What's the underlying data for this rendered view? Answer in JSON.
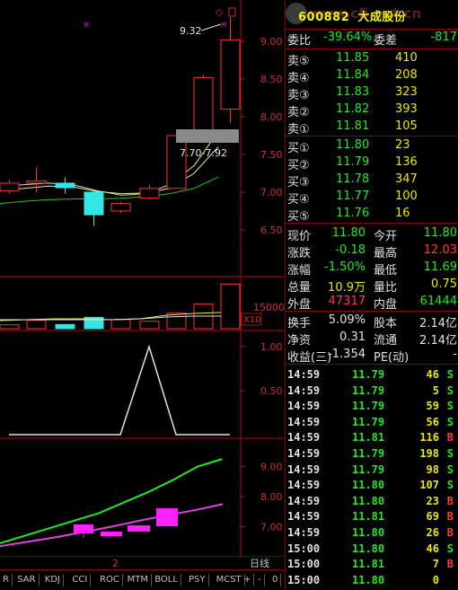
{
  "stock": {
    "code": "600882",
    "name": "大成股份",
    "watermark": "www.cfi.net.cn"
  },
  "chart": {
    "price_axis": [
      "9.00",
      "8.50",
      "8.00",
      "7.50",
      "7.00",
      "6.50"
    ],
    "volume_axis": "15000",
    "volume_unit": "X10",
    "kdj_axis": [
      "1.00",
      "0.50"
    ],
    "ma_axis": [
      "9.00",
      "8.00",
      "7.00"
    ],
    "peak_label": "9.32",
    "box_label": "7.70-7.92",
    "cursor_mark": "2",
    "period_label": "日线"
  },
  "chart_data": {
    "type": "candlestick",
    "candles": [
      {
        "open": 7.02,
        "close": 7.12,
        "high": 7.17,
        "low": 6.98
      },
      {
        "open": 7.12,
        "close": 7.15,
        "high": 7.33,
        "low": 7.0
      },
      {
        "open": 7.12,
        "close": 7.06,
        "high": 7.2,
        "low": 6.98
      },
      {
        "open": 7.0,
        "close": 6.7,
        "high": 7.01,
        "low": 6.55
      },
      {
        "open": 6.75,
        "close": 6.85,
        "high": 6.87,
        "low": 6.72
      },
      {
        "open": 6.92,
        "close": 7.05,
        "high": 7.1,
        "low": 6.9
      },
      {
        "open": 7.05,
        "close": 7.75,
        "high": 7.75,
        "low": 7.05
      },
      {
        "open": 7.78,
        "close": 8.52,
        "high": 8.55,
        "low": 7.78
      },
      {
        "open": 8.1,
        "close": 9.02,
        "high": 9.32,
        "low": 7.92
      }
    ],
    "volume": [
      1200,
      2600,
      1300,
      3500,
      2800,
      2300,
      4800,
      7600,
      13800
    ],
    "kdj": [
      0,
      0,
      0,
      0,
      0,
      1.0,
      0,
      0,
      0
    ],
    "ma_green": [
      6.45,
      6.7,
      6.95,
      7.2,
      7.45,
      7.8,
      8.15,
      8.55,
      9.0,
      9.25
    ],
    "ma_magenta": [
      6.35,
      6.5,
      6.65,
      6.82,
      7.0,
      7.2,
      7.38,
      7.55,
      7.75
    ]
  },
  "quote": {
    "weibi_label": "委比",
    "weibi": "-39.64%",
    "weicha_label": "委差",
    "weicha": "-817",
    "asks": [
      {
        "label": "卖⑤",
        "price": "11.85",
        "vol": "410"
      },
      {
        "label": "卖④",
        "price": "11.84",
        "vol": "208"
      },
      {
        "label": "卖③",
        "price": "11.83",
        "vol": "323"
      },
      {
        "label": "卖②",
        "price": "11.82",
        "vol": "393"
      },
      {
        "label": "卖①",
        "price": "11.81",
        "vol": "105"
      }
    ],
    "bids": [
      {
        "label": "买①",
        "price": "11.80",
        "vol": "23"
      },
      {
        "label": "买②",
        "price": "11.79",
        "vol": "136"
      },
      {
        "label": "买③",
        "price": "11.78",
        "vol": "347"
      },
      {
        "label": "买④",
        "price": "11.77",
        "vol": "100"
      },
      {
        "label": "买⑤",
        "price": "11.76",
        "vol": "16"
      }
    ],
    "stats1": [
      {
        "l1": "现价",
        "v1": "11.80",
        "c1": "green",
        "l2": "今开",
        "v2": "11.80",
        "c2": "green"
      },
      {
        "l1": "涨跌",
        "v1": "-0.18",
        "c1": "green",
        "l2": "最高",
        "v2": "12.03",
        "c2": "red"
      },
      {
        "l1": "涨幅",
        "v1": "-1.50%",
        "c1": "green",
        "l2": "最低",
        "v2": "11.69",
        "c2": "green"
      },
      {
        "l1": "总量",
        "v1": "10.9万",
        "c1": "yellow",
        "l2": "量比",
        "v2": "0.75",
        "c2": "yellow"
      },
      {
        "l1": "外盘",
        "v1": "47317",
        "c1": "red",
        "l2": "内盘",
        "v2": "61444",
        "c2": "green"
      }
    ],
    "stats2": [
      {
        "l1": "换手",
        "v1": "5.09%",
        "l2": "股本",
        "v2": "2.14亿"
      },
      {
        "l1": "净资",
        "v1": "0.31",
        "l2": "流通",
        "v2": "2.14亿"
      },
      {
        "l1": "收益(三)",
        "v1": "-1.354",
        "l2": "PE(动)",
        "v2": "-"
      }
    ]
  },
  "ticks": [
    {
      "time": "14:59",
      "price": "11.79",
      "vol": "46",
      "side": "S"
    },
    {
      "time": "14:59",
      "price": "11.79",
      "vol": "5",
      "side": "S"
    },
    {
      "time": "14:59",
      "price": "11.79",
      "vol": "59",
      "side": "S"
    },
    {
      "time": "14:59",
      "price": "11.79",
      "vol": "56",
      "side": "S"
    },
    {
      "time": "14:59",
      "price": "11.81",
      "vol": "116",
      "side": "B"
    },
    {
      "time": "14:59",
      "price": "11.79",
      "vol": "198",
      "side": "S"
    },
    {
      "time": "14:59",
      "price": "11.79",
      "vol": "98",
      "side": "S"
    },
    {
      "time": "14:59",
      "price": "11.80",
      "vol": "107",
      "side": "S"
    },
    {
      "time": "14:59",
      "price": "11.80",
      "vol": "23",
      "side": "B"
    },
    {
      "time": "14:59",
      "price": "11.81",
      "vol": "69",
      "side": "B"
    },
    {
      "time": "14:59",
      "price": "11.80",
      "vol": "26",
      "side": "B"
    },
    {
      "time": "15:00",
      "price": "11.80",
      "vol": "46",
      "side": "S"
    },
    {
      "time": "15:00",
      "price": "11.81",
      "vol": "7",
      "side": "B"
    },
    {
      "time": "15:00",
      "price": "11.80",
      "vol": "0",
      "side": ""
    }
  ],
  "tabs": [
    "R",
    "SAR",
    "KDJ",
    "CCI",
    "ROC",
    "MTM",
    "BOLL",
    "PSY",
    "MCST"
  ],
  "tab_controls": [
    "+",
    "-",
    "0"
  ]
}
